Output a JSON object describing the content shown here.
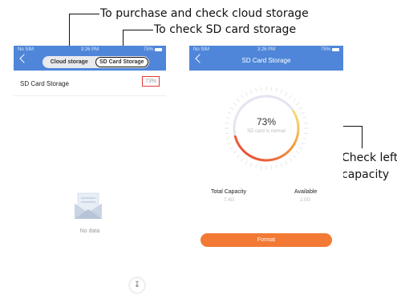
{
  "annotations": {
    "cloud": "To purchase and check cloud storage",
    "sdcard": "To check SD card storage",
    "capacity_line1": "Check left",
    "capacity_line2": "capacity"
  },
  "status_bar": {
    "carrier": "No SIM",
    "time": "3:26 PM",
    "battery": "75%"
  },
  "left_screen": {
    "tabs": [
      {
        "label": "Cloud storage",
        "active": false
      },
      {
        "label": "SD Card Storage",
        "active": true
      }
    ],
    "row": {
      "label": "SD Card Storage",
      "value": "73%"
    },
    "empty_text": "No data",
    "download_icon": "arrow-down-icon"
  },
  "right_screen": {
    "title": "SD Card Storage",
    "gauge": {
      "percent_label": "73%",
      "status": "SD card is normal",
      "fraction": 0.73
    },
    "total_label": "Total Capacity",
    "total_value": "7.4G",
    "available_label": "Available",
    "available_value": "2.0G",
    "format_label": "Format"
  },
  "colors": {
    "header": "#4f86d9",
    "format_button": "#f27a34",
    "highlight_border": "#e03b3b"
  }
}
